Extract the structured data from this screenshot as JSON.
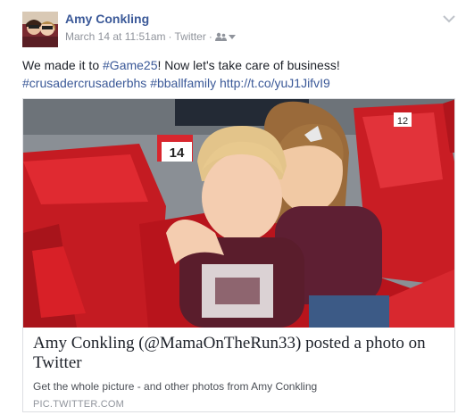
{
  "post": {
    "author": "Amy Conkling",
    "timestamp": "March 14 at 11:51am",
    "via": "Twitter",
    "separator": "·",
    "privacy_icon": "friends-icon",
    "menu_icon": "chevron-down-icon"
  },
  "message": {
    "text1": "We made it to ",
    "tag1": "#Game25",
    "text2": "! Now let's take care of business!",
    "tag2": "#crusadercrusaderbhs",
    "tag3": "#bballfamily",
    "link": "http://t.co/yuJ1JifvI9"
  },
  "attachment": {
    "seat_label_14": "14",
    "seat_label_12": "12",
    "title": "Amy Conkling (@MamaOnTheRun33) posted a photo on Twitter",
    "description": "Get the whole picture - and other photos from Amy Conkling",
    "domain": "PIC.TWITTER.COM"
  },
  "colors": {
    "link": "#3b5998",
    "meta": "#90949c",
    "seat_red": "#cc1f26"
  }
}
